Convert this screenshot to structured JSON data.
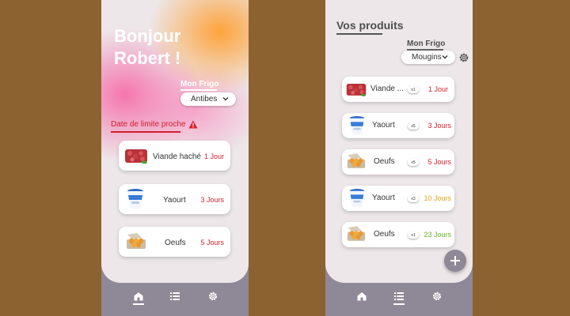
{
  "home": {
    "greeting_line1": "Bonjour",
    "greeting_line2": "Robert !",
    "fridge_label": "Mon Frigo",
    "fridge_selected": "Antibes",
    "alert_title": "Date de limite proche",
    "items": [
      {
        "name": "Viande haché",
        "days": "1 Jour",
        "image": "meat-icon"
      },
      {
        "name": "Yaourt",
        "days": "3 Jours",
        "image": "yogurt-icon"
      },
      {
        "name": "Oeufs",
        "days": "5 Jours",
        "image": "eggs-icon"
      }
    ]
  },
  "products": {
    "title": "Vos produits",
    "fridge_label": "Mon Frigo",
    "fridge_selected": "Mougins",
    "items": [
      {
        "name": "Viande ...",
        "qty": "x1",
        "days": "1 Jour",
        "image": "meat-icon",
        "status": "urgent"
      },
      {
        "name": "Yaourt",
        "qty": "x5",
        "days": "3 Jours",
        "image": "yogurt-icon",
        "status": "urgent"
      },
      {
        "name": "Oeufs",
        "qty": "x5",
        "days": "5 Jours",
        "image": "eggs-icon",
        "status": "urgent"
      },
      {
        "name": "Yaourt",
        "qty": "x3",
        "days": "10 Jours",
        "image": "yogurt-icon",
        "status": "warning"
      },
      {
        "name": "Oeufs",
        "qty": "x1",
        "days": "23 Jours",
        "image": "eggs-icon",
        "status": "ok"
      }
    ],
    "add_button_icon": "plus-icon"
  },
  "nav": {
    "items": [
      "home-icon",
      "list-icon",
      "gear-icon"
    ]
  },
  "colors": {
    "urgent": "#d8202e",
    "warning": "#e0a21a",
    "ok": "#62b82a",
    "nav_bg": "#8f8896",
    "page_bg": "#8c6231"
  }
}
